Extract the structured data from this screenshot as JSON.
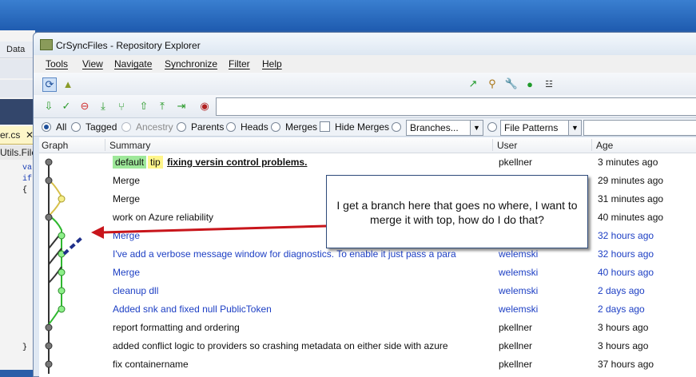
{
  "background_app": {
    "menu_label": "Data",
    "tab_file": "er.cs",
    "tab_file2": "Utils.File",
    "code_lines": [
      "va",
      "if",
      "{",
      "}"
    ]
  },
  "window": {
    "title": "CrSyncFiles - Repository Explorer",
    "menu": [
      "Tools",
      "View",
      "Navigate",
      "Synchronize",
      "Filter",
      "Help"
    ]
  },
  "filters": {
    "radios": [
      {
        "label": "All",
        "selected": true,
        "enabled": true
      },
      {
        "label": "Tagged",
        "selected": false,
        "enabled": true
      },
      {
        "label": "Ancestry",
        "selected": false,
        "enabled": false
      },
      {
        "label": "Parents",
        "selected": false,
        "enabled": true
      },
      {
        "label": "Heads",
        "selected": false,
        "enabled": true
      },
      {
        "label": "Merges",
        "selected": false,
        "enabled": true
      }
    ],
    "hide_merges_label": "Hide Merges",
    "branches_combo": "Branches...",
    "file_patterns_combo": "File Patterns"
  },
  "columns": {
    "graph": "Graph",
    "summary": "Summary",
    "user": "User",
    "age": "Age"
  },
  "rows": [
    {
      "tags": [
        "default",
        "tip"
      ],
      "summary": "fixing versin control problems.",
      "user": "pkellner",
      "age": "3 minutes ago",
      "style": "bold"
    },
    {
      "summary": "Merge",
      "user": "",
      "age": "29 minutes ago",
      "style": "normal"
    },
    {
      "summary": "Merge",
      "user": "",
      "age": "31 minutes ago",
      "style": "normal"
    },
    {
      "summary": "work on Azure reliability",
      "user": "",
      "age": "40 minutes ago",
      "style": "normal"
    },
    {
      "summary": "Merge",
      "user": "",
      "age": "32 hours ago",
      "style": "blue"
    },
    {
      "summary": "I've add a verbose message window for diagnostics. To enable it just pass a para",
      "user": "welemski",
      "age": "32 hours ago",
      "style": "blue"
    },
    {
      "summary": "Merge",
      "user": "welemski",
      "age": "40 hours ago",
      "style": "blue"
    },
    {
      "summary": "cleanup dll",
      "user": "welemski",
      "age": "2 days ago",
      "style": "blue"
    },
    {
      "summary": "Added snk and fixed null PublicToken",
      "user": "welemski",
      "age": "2 days ago",
      "style": "blue"
    },
    {
      "summary": "report formatting and ordering",
      "user": "pkellner",
      "age": "3 hours ago",
      "style": "normal"
    },
    {
      "summary": "added conflict logic to providers so crashing metadata on either side with azure",
      "user": "pkellner",
      "age": "3 hours ago",
      "style": "normal"
    },
    {
      "summary": "fix containername",
      "user": "pkellner",
      "age": "37 hours ago",
      "style": "normal"
    }
  ],
  "callout_text": "I get a branch here that goes no where, I want to merge it with top, how do I do that?",
  "colors": {
    "accent_blue": "#1d3fc4",
    "branch_green": "#2fb82f",
    "arrow_red": "#c8151b",
    "callout_border": "#2d4a7a"
  }
}
